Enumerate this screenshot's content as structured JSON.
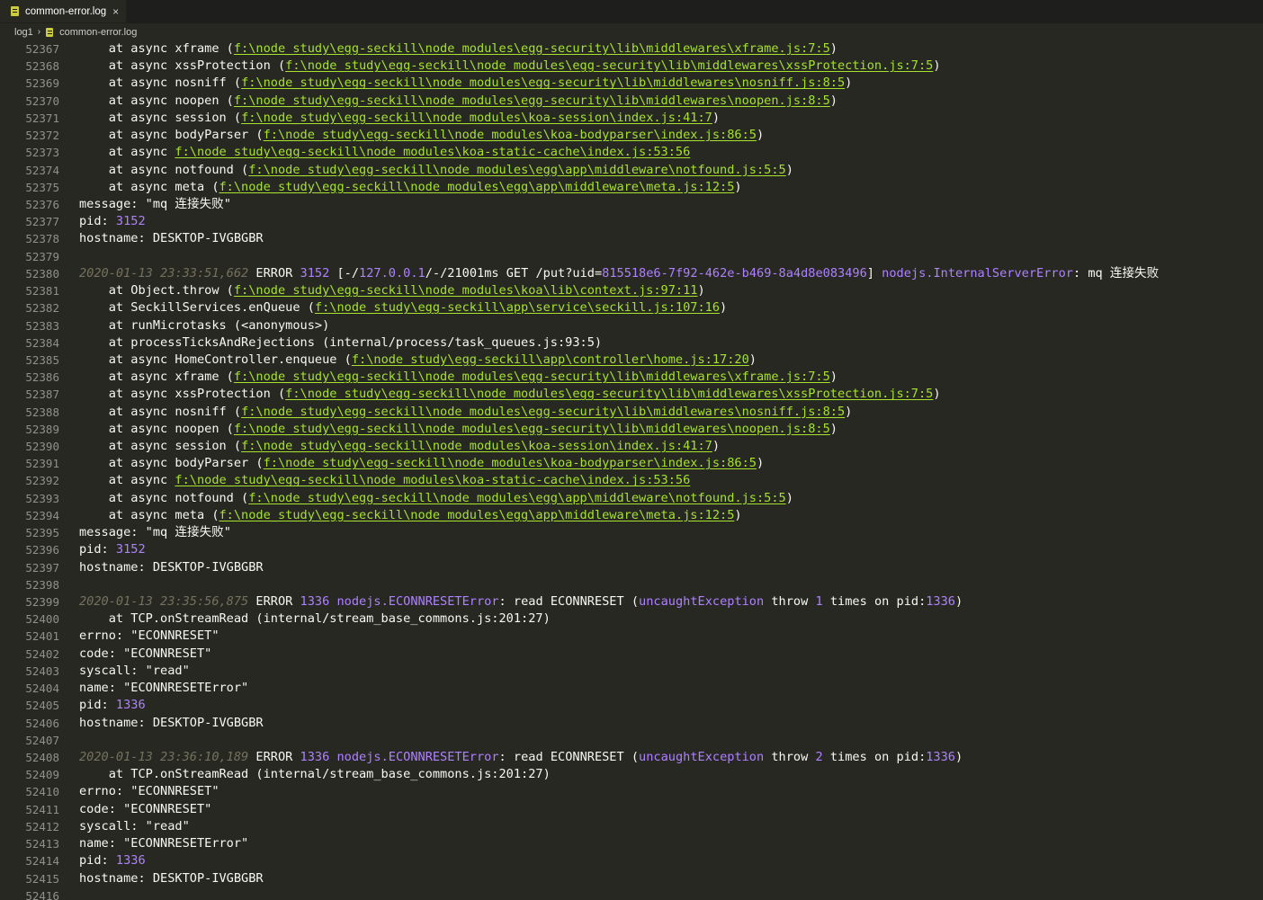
{
  "tab": {
    "title": "common-error.log",
    "close": "×",
    "icon": "file-log-icon"
  },
  "breadcrumb": {
    "folder": "log1",
    "separator": "›",
    "file": "common-error.log"
  },
  "colors": {
    "background": "#272822",
    "timestamp": "#75715e",
    "path": "#a6e22e",
    "number": "#ae81ff",
    "string": "#e6db74"
  },
  "lines": [
    {
      "n": "52367",
      "segs": [
        [
          "k",
          "    at async xframe ("
        ],
        [
          "p",
          "f:\\node_study\\egg-seckill\\node_modules\\egg-security\\lib\\middlewares\\xframe.js:7:5"
        ],
        [
          "k",
          ")"
        ]
      ]
    },
    {
      "n": "52368",
      "segs": [
        [
          "k",
          "    at async xssProtection ("
        ],
        [
          "p",
          "f:\\node_study\\egg-seckill\\node_modules\\egg-security\\lib\\middlewares\\xssProtection.js:7:5"
        ],
        [
          "k",
          ")"
        ]
      ]
    },
    {
      "n": "52369",
      "segs": [
        [
          "k",
          "    at async nosniff ("
        ],
        [
          "p",
          "f:\\node_study\\egg-seckill\\node_modules\\egg-security\\lib\\middlewares\\nosniff.js:8:5"
        ],
        [
          "k",
          ")"
        ]
      ]
    },
    {
      "n": "52370",
      "segs": [
        [
          "k",
          "    at async noopen ("
        ],
        [
          "p",
          "f:\\node_study\\egg-seckill\\node_modules\\egg-security\\lib\\middlewares\\noopen.js:8:5"
        ],
        [
          "k",
          ")"
        ]
      ]
    },
    {
      "n": "52371",
      "segs": [
        [
          "k",
          "    at async session ("
        ],
        [
          "p",
          "f:\\node_study\\egg-seckill\\node_modules\\koa-session\\index.js:41:7"
        ],
        [
          "k",
          ")"
        ]
      ]
    },
    {
      "n": "52372",
      "segs": [
        [
          "k",
          "    at async bodyParser ("
        ],
        [
          "p",
          "f:\\node_study\\egg-seckill\\node_modules\\koa-bodyparser\\index.js:86:5"
        ],
        [
          "k",
          ")"
        ]
      ]
    },
    {
      "n": "52373",
      "segs": [
        [
          "k",
          "    at async "
        ],
        [
          "p",
          "f:\\node_study\\egg-seckill\\node_modules\\koa-static-cache\\index.js:53:56"
        ]
      ]
    },
    {
      "n": "52374",
      "segs": [
        [
          "k",
          "    at async notfound ("
        ],
        [
          "p",
          "f:\\node_study\\egg-seckill\\node_modules\\egg\\app\\middleware\\notfound.js:5:5"
        ],
        [
          "k",
          ")"
        ]
      ]
    },
    {
      "n": "52375",
      "segs": [
        [
          "k",
          "    at async meta ("
        ],
        [
          "p",
          "f:\\node_study\\egg-seckill\\node_modules\\egg\\app\\middleware\\meta.js:12:5"
        ],
        [
          "k",
          ")"
        ]
      ]
    },
    {
      "n": "52376",
      "segs": [
        [
          "k",
          "message: \"mq 连接失败\""
        ]
      ]
    },
    {
      "n": "52377",
      "segs": [
        [
          "k",
          "pid: "
        ],
        [
          "s",
          "3152"
        ]
      ]
    },
    {
      "n": "52378",
      "segs": [
        [
          "k",
          "hostname: DESKTOP-IVGBGBR"
        ]
      ]
    },
    {
      "n": "52379",
      "segs": []
    },
    {
      "n": "52380",
      "segs": [
        [
          "t",
          "2020-01-13 23:33:51,662"
        ],
        [
          "k",
          " ERROR "
        ],
        [
          "s",
          "3152"
        ],
        [
          "k",
          " [-/"
        ],
        [
          "s",
          "127.0.0.1"
        ],
        [
          "k",
          "/-/21001ms GET /put?uid="
        ],
        [
          "s",
          "815518e6-7f92-462e-b469-8a4d8e083496"
        ],
        [
          "k",
          "] "
        ],
        [
          "s",
          "nodejs.InternalServerError"
        ],
        [
          "k",
          ": mq 连接失败"
        ]
      ]
    },
    {
      "n": "52381",
      "segs": [
        [
          "k",
          "    at Object.throw ("
        ],
        [
          "p",
          "f:\\node_study\\egg-seckill\\node_modules\\koa\\lib\\context.js:97:11"
        ],
        [
          "k",
          ")"
        ]
      ]
    },
    {
      "n": "52382",
      "segs": [
        [
          "k",
          "    at SeckillServices.enQueue ("
        ],
        [
          "p",
          "f:\\node_study\\egg-seckill\\app\\service\\seckill.js:107:16"
        ],
        [
          "k",
          ")"
        ]
      ]
    },
    {
      "n": "52383",
      "segs": [
        [
          "k",
          "    at runMicrotasks (<anonymous>)"
        ]
      ]
    },
    {
      "n": "52384",
      "segs": [
        [
          "k",
          "    at processTicksAndRejections (internal/process/task_queues.js:93:5)"
        ]
      ]
    },
    {
      "n": "52385",
      "segs": [
        [
          "k",
          "    at async HomeController.enqueue ("
        ],
        [
          "p",
          "f:\\node_study\\egg-seckill\\app\\controller\\home.js:17:20"
        ],
        [
          "k",
          ")"
        ]
      ]
    },
    {
      "n": "52386",
      "segs": [
        [
          "k",
          "    at async xframe ("
        ],
        [
          "p",
          "f:\\node_study\\egg-seckill\\node_modules\\egg-security\\lib\\middlewares\\xframe.js:7:5"
        ],
        [
          "k",
          ")"
        ]
      ]
    },
    {
      "n": "52387",
      "segs": [
        [
          "k",
          "    at async xssProtection ("
        ],
        [
          "p",
          "f:\\node_study\\egg-seckill\\node_modules\\egg-security\\lib\\middlewares\\xssProtection.js:7:5"
        ],
        [
          "k",
          ")"
        ]
      ]
    },
    {
      "n": "52388",
      "segs": [
        [
          "k",
          "    at async nosniff ("
        ],
        [
          "p",
          "f:\\node_study\\egg-seckill\\node_modules\\egg-security\\lib\\middlewares\\nosniff.js:8:5"
        ],
        [
          "k",
          ")"
        ]
      ]
    },
    {
      "n": "52389",
      "segs": [
        [
          "k",
          "    at async noopen ("
        ],
        [
          "p",
          "f:\\node_study\\egg-seckill\\node_modules\\egg-security\\lib\\middlewares\\noopen.js:8:5"
        ],
        [
          "k",
          ")"
        ]
      ]
    },
    {
      "n": "52390",
      "segs": [
        [
          "k",
          "    at async session ("
        ],
        [
          "p",
          "f:\\node_study\\egg-seckill\\node_modules\\koa-session\\index.js:41:7"
        ],
        [
          "k",
          ")"
        ]
      ]
    },
    {
      "n": "52391",
      "segs": [
        [
          "k",
          "    at async bodyParser ("
        ],
        [
          "p",
          "f:\\node_study\\egg-seckill\\node_modules\\koa-bodyparser\\index.js:86:5"
        ],
        [
          "k",
          ")"
        ]
      ]
    },
    {
      "n": "52392",
      "segs": [
        [
          "k",
          "    at async "
        ],
        [
          "p",
          "f:\\node_study\\egg-seckill\\node_modules\\koa-static-cache\\index.js:53:56"
        ]
      ]
    },
    {
      "n": "52393",
      "segs": [
        [
          "k",
          "    at async notfound ("
        ],
        [
          "p",
          "f:\\node_study\\egg-seckill\\node_modules\\egg\\app\\middleware\\notfound.js:5:5"
        ],
        [
          "k",
          ")"
        ]
      ]
    },
    {
      "n": "52394",
      "segs": [
        [
          "k",
          "    at async meta ("
        ],
        [
          "p",
          "f:\\node_study\\egg-seckill\\node_modules\\egg\\app\\middleware\\meta.js:12:5"
        ],
        [
          "k",
          ")"
        ]
      ]
    },
    {
      "n": "52395",
      "segs": [
        [
          "k",
          "message: \"mq 连接失败\""
        ]
      ]
    },
    {
      "n": "52396",
      "segs": [
        [
          "k",
          "pid: "
        ],
        [
          "s",
          "3152"
        ]
      ]
    },
    {
      "n": "52397",
      "segs": [
        [
          "k",
          "hostname: DESKTOP-IVGBGBR"
        ]
      ]
    },
    {
      "n": "52398",
      "segs": []
    },
    {
      "n": "52399",
      "segs": [
        [
          "t",
          "2020-01-13 23:35:56,875"
        ],
        [
          "k",
          " ERROR "
        ],
        [
          "s",
          "1336"
        ],
        [
          "k",
          " "
        ],
        [
          "s",
          "nodejs.ECONNRESETError"
        ],
        [
          "k",
          ": read ECONNRESET ("
        ],
        [
          "s",
          "uncaughtException"
        ],
        [
          "k",
          " throw "
        ],
        [
          "s",
          "1"
        ],
        [
          "k",
          " times on pid:"
        ],
        [
          "s",
          "1336"
        ],
        [
          "k",
          ")"
        ]
      ]
    },
    {
      "n": "52400",
      "segs": [
        [
          "k",
          "    at TCP.onStreamRead (internal/stream_base_commons.js:201:27)"
        ]
      ]
    },
    {
      "n": "52401",
      "segs": [
        [
          "k",
          "errno: \"ECONNRESET\""
        ]
      ]
    },
    {
      "n": "52402",
      "segs": [
        [
          "k",
          "code: \"ECONNRESET\""
        ]
      ]
    },
    {
      "n": "52403",
      "segs": [
        [
          "k",
          "syscall: \"read\""
        ]
      ]
    },
    {
      "n": "52404",
      "segs": [
        [
          "k",
          "name: \"ECONNRESETError\""
        ]
      ]
    },
    {
      "n": "52405",
      "segs": [
        [
          "k",
          "pid: "
        ],
        [
          "s",
          "1336"
        ]
      ]
    },
    {
      "n": "52406",
      "segs": [
        [
          "k",
          "hostname: DESKTOP-IVGBGBR"
        ]
      ]
    },
    {
      "n": "52407",
      "segs": []
    },
    {
      "n": "52408",
      "segs": [
        [
          "t",
          "2020-01-13 23:36:10,189"
        ],
        [
          "k",
          " ERROR "
        ],
        [
          "s",
          "1336"
        ],
        [
          "k",
          " "
        ],
        [
          "s",
          "nodejs.ECONNRESETError"
        ],
        [
          "k",
          ": read ECONNRESET ("
        ],
        [
          "s",
          "uncaughtException"
        ],
        [
          "k",
          " throw "
        ],
        [
          "s",
          "2"
        ],
        [
          "k",
          " times on pid:"
        ],
        [
          "s",
          "1336"
        ],
        [
          "k",
          ")"
        ]
      ]
    },
    {
      "n": "52409",
      "segs": [
        [
          "k",
          "    at TCP.onStreamRead (internal/stream_base_commons.js:201:27)"
        ]
      ]
    },
    {
      "n": "52410",
      "segs": [
        [
          "k",
          "errno: \"ECONNRESET\""
        ]
      ]
    },
    {
      "n": "52411",
      "segs": [
        [
          "k",
          "code: \"ECONNRESET\""
        ]
      ]
    },
    {
      "n": "52412",
      "segs": [
        [
          "k",
          "syscall: \"read\""
        ]
      ]
    },
    {
      "n": "52413",
      "segs": [
        [
          "k",
          "name: \"ECONNRESETError\""
        ]
      ]
    },
    {
      "n": "52414",
      "segs": [
        [
          "k",
          "pid: "
        ],
        [
          "s",
          "1336"
        ]
      ]
    },
    {
      "n": "52415",
      "segs": [
        [
          "k",
          "hostname: DESKTOP-IVGBGBR"
        ]
      ]
    },
    {
      "n": "52416",
      "segs": []
    }
  ]
}
